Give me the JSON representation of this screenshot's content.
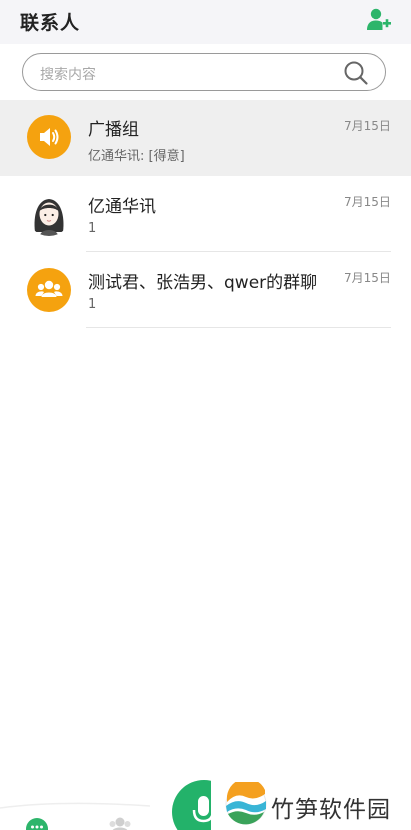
{
  "header": {
    "title": "联系人",
    "add_icon": "add-user-icon"
  },
  "search": {
    "placeholder": "搜索内容",
    "icon": "search-icon"
  },
  "conversations": [
    {
      "name": "广播组",
      "subtitle": "亿通华讯: [得意]",
      "date": "7月15日",
      "avatar": "speaker-icon",
      "selected": true
    },
    {
      "name": "亿通华讯",
      "subtitle": "1",
      "date": "7月15日",
      "avatar": "female-avatar",
      "selected": false
    },
    {
      "name": "测试君、张浩男、qwer的群聊",
      "subtitle": "1",
      "date": "7月15日",
      "avatar": "group-icon",
      "selected": false
    }
  ],
  "bottom_nav": {
    "chat_icon": "chat-icon",
    "contacts_icon": "contacts-icon",
    "mic_icon": "microphone-icon"
  },
  "watermark": {
    "text": "竹笋软件园"
  },
  "colors": {
    "accent_green": "#2db56b",
    "avatar_orange": "#f5a20f",
    "header_bg": "#f5f5f8",
    "selected_bg": "#efefef"
  }
}
